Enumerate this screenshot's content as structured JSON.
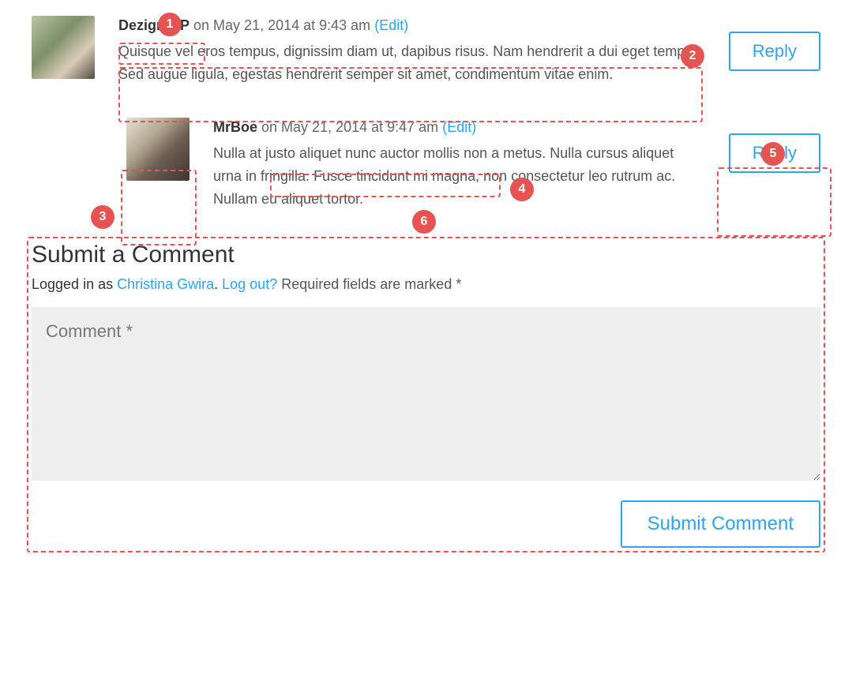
{
  "comments": [
    {
      "author": "Dezign OP",
      "timestamp": "on May 21, 2014 at 9:43 am",
      "edit_label": "(Edit)",
      "body": "Quisque vel eros tempus, dignissim diam ut, dapibus risus. Nam hendrerit a dui eget tempor. Sed augue ligula, egestas hendrerit semper sit amet, condimentum vitae enim.",
      "reply_label": "Reply"
    },
    {
      "author": "MrBoe",
      "timestamp": "on May 21, 2014 at 9:47 am",
      "edit_label": "(Edit)",
      "body": "Nulla at justo aliquet nunc auctor mollis non a metus. Nulla cursus aliquet urna in fringilla. Fusce tincidunt mi magna, non consectetur leo rutrum ac. Nullam eu aliquet tortor.",
      "reply_label": "Reply"
    }
  ],
  "form": {
    "heading": "Submit a Comment",
    "logged_in_prefix": "Logged in as ",
    "logged_in_user": "Christina Gwira",
    "logged_in_sep": ". ",
    "logout_label": "Log out?",
    "required_text": " Required fields are marked *",
    "placeholder": "Comment *",
    "submit_label": "Submit Comment"
  },
  "annotations": {
    "b1": "1",
    "b2": "2",
    "b3": "3",
    "b4": "4",
    "b5": "5",
    "b6": "6"
  }
}
